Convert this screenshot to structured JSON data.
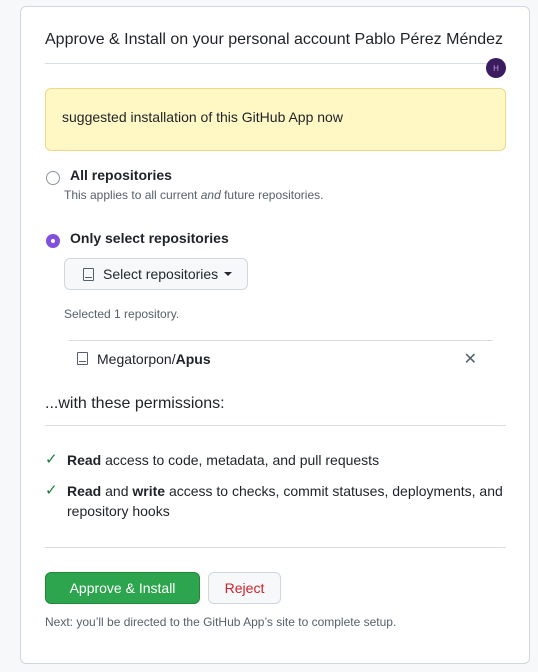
{
  "header": {
    "title": "Approve & Install on your personal account Pablo Pérez Méndez",
    "avatar_initial": "H"
  },
  "flash": {
    "message": "suggested installation of this GitHub App now"
  },
  "options": {
    "all": {
      "label": "All repositories",
      "note_prefix": "This applies to all current ",
      "note_em": "and",
      "note_suffix": " future repositories.",
      "selected": false
    },
    "select": {
      "label": "Only select repositories",
      "selected": true
    }
  },
  "repo_picker": {
    "button_label": "Select repositories",
    "selected_count_text": "Selected 1 repository.",
    "repos": [
      {
        "owner": "Megatorpon/",
        "name": "Apus"
      }
    ]
  },
  "permissions": {
    "heading": "...with these permissions:",
    "items": [
      {
        "b1": "Read",
        "mid": " access to code, metadata, and pull requests"
      },
      {
        "b1": "Read",
        "and": " and ",
        "b2": "write",
        "mid": " access to checks, commit statuses, deployments, and repository hooks"
      }
    ]
  },
  "actions": {
    "approve_label": "Approve & Install",
    "reject_label": "Reject",
    "footer_note": "Next: you’ll be directed to the GitHub App’s site to complete setup."
  },
  "colors": {
    "primary_green": "#2da44e",
    "danger_red": "#cf222e",
    "radio_purple": "#8250df",
    "flash_bg": "#fff8c5"
  }
}
